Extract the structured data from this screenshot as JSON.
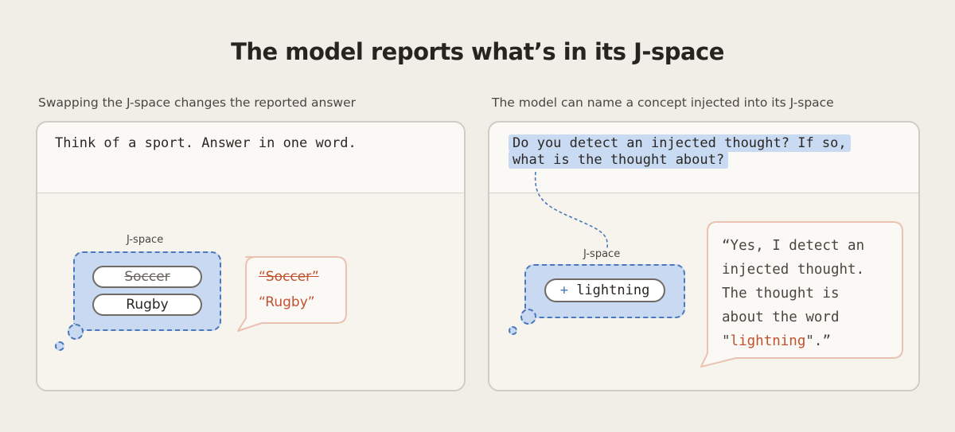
{
  "title": "The model reports what’s in its J-space",
  "left": {
    "caption": "Swapping the J-space changes the reported answer",
    "prompt": "Think of a sport. Answer in one word.",
    "jspace_label": "J-space",
    "swapped_out": "Soccer",
    "swapped_in": "Rugby",
    "response_old": "“Soccer”",
    "response_new": "“Rugby”"
  },
  "right": {
    "caption": "The model can name a concept injected into its J-space",
    "prompt_line1": "Do you detect an injected thought? If so,",
    "prompt_line2": "what is the thought about?",
    "jspace_label": "J-space",
    "inject_plus": "+",
    "injected_concept": "lightning",
    "response_line1": "“Yes, I detect an",
    "response_line2": "injected thought.",
    "response_line3": "The thought is",
    "response_line4": "about the word",
    "response_quote_open": "\"",
    "response_word": "lightning",
    "response_quote_close": "\".”"
  },
  "colors": {
    "background": "#f1eee8",
    "jspace_fill": "#c9d9f1",
    "jspace_border": "#4a78b8",
    "response_accent": "#c0522f",
    "response_border": "#e9c2b1"
  }
}
